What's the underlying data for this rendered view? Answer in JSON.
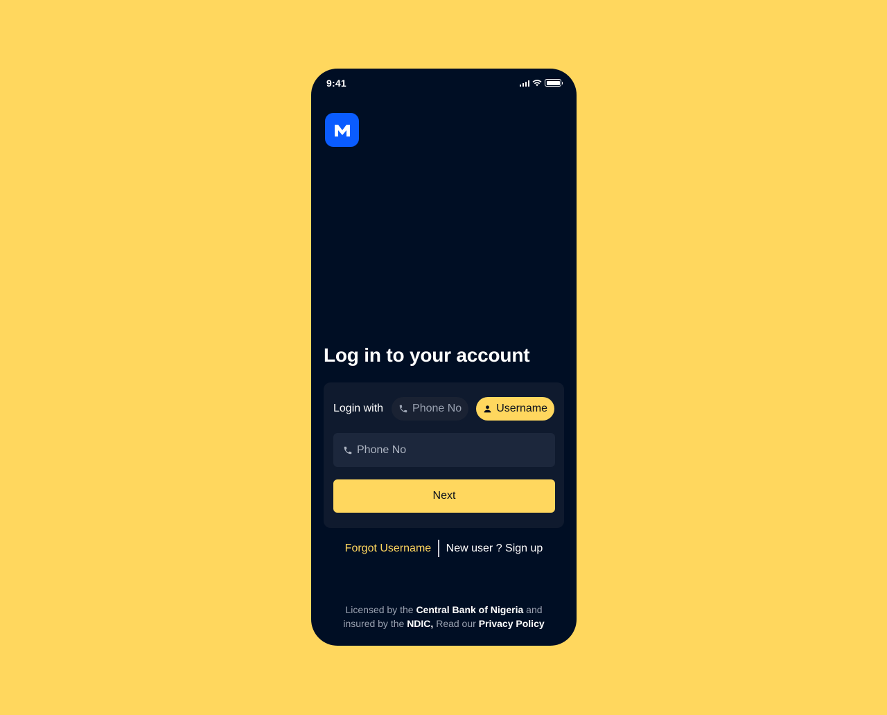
{
  "status_bar": {
    "time": "9:41"
  },
  "brand": {
    "logo_letter": "M",
    "logo_color": "#0A5CFF",
    "accent_color": "#FFD75E",
    "background_color": "#000E24"
  },
  "title": "Log in to your account",
  "login_with": {
    "label": "Login with",
    "options": [
      {
        "label": "Phone No",
        "icon": "phone-icon",
        "selected": false
      },
      {
        "label": "Username",
        "icon": "user-icon",
        "selected": true
      }
    ]
  },
  "input": {
    "placeholder": "Phone No",
    "icon": "phone-icon"
  },
  "next_button": "Next",
  "links": {
    "forgot": "Forgot Username",
    "signup": "New user ? Sign up"
  },
  "footer": {
    "part1": "Licensed by the ",
    "cbn": "Central Bank of Nigeria",
    "part2": " and",
    "part3": "insured by the ",
    "ndic": "NDIC,",
    "part4": " Read our ",
    "privacy": "Privacy Policy"
  }
}
